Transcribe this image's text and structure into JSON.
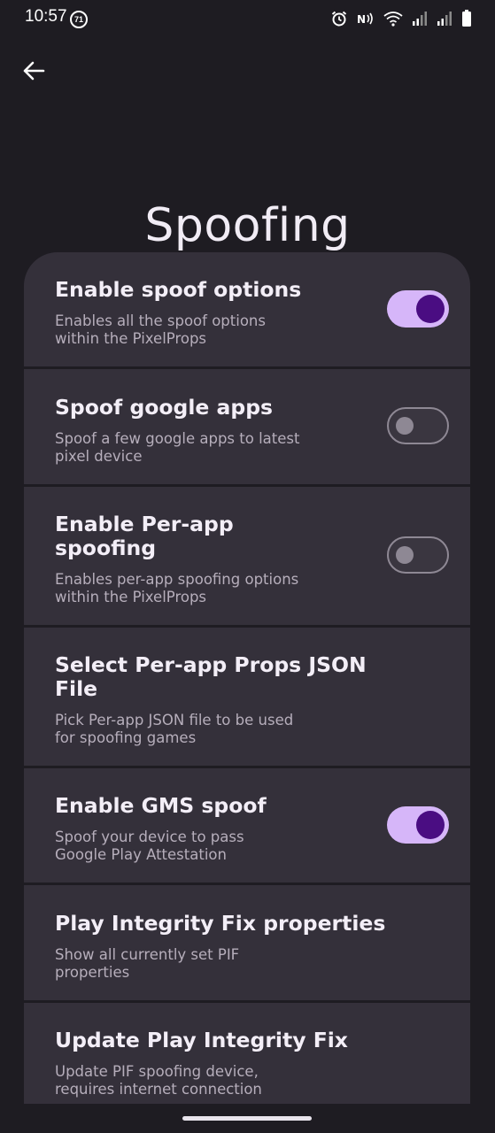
{
  "status_bar": {
    "time": "10:57",
    "notification_count": "71",
    "icons": [
      "alarm-icon",
      "nfc-icon",
      "wifi-icon",
      "signal-icon",
      "signal-icon",
      "battery-icon"
    ]
  },
  "header": {
    "back_icon": "arrow-left-icon",
    "title": "Spoofing"
  },
  "settings": [
    {
      "title": "Enable spoof options",
      "summary": "Enables all the spoof options within the PixelProps",
      "toggle": "on"
    },
    {
      "title": "Spoof google apps",
      "summary": "Spoof a few google apps to latest pixel device",
      "toggle": "off"
    },
    {
      "title": "Enable Per-app spoofing",
      "summary": "Enables per-app spoofing options within the PixelProps",
      "toggle": "off"
    },
    {
      "title": "Select Per-app Props JSON File",
      "summary": "Pick Per-app JSON file to be used for spoofing games",
      "toggle": null
    },
    {
      "title": "Enable GMS spoof",
      "summary": "Spoof your device to pass Google Play Attestation",
      "toggle": "on"
    },
    {
      "title": "Play Integrity Fix properties",
      "summary": "Show all currently set PIF properties",
      "toggle": null
    },
    {
      "title": "Update Play Integrity Fix",
      "summary": "Update PIF spoofing device, requires internet connection",
      "toggle": null
    }
  ],
  "colors": {
    "background": "#1e1c22",
    "card": "#34303a",
    "toggle_on_track": "#d6b6f9",
    "toggle_on_knob": "#4a0d82",
    "toggle_off_outline": "#8e8894"
  }
}
